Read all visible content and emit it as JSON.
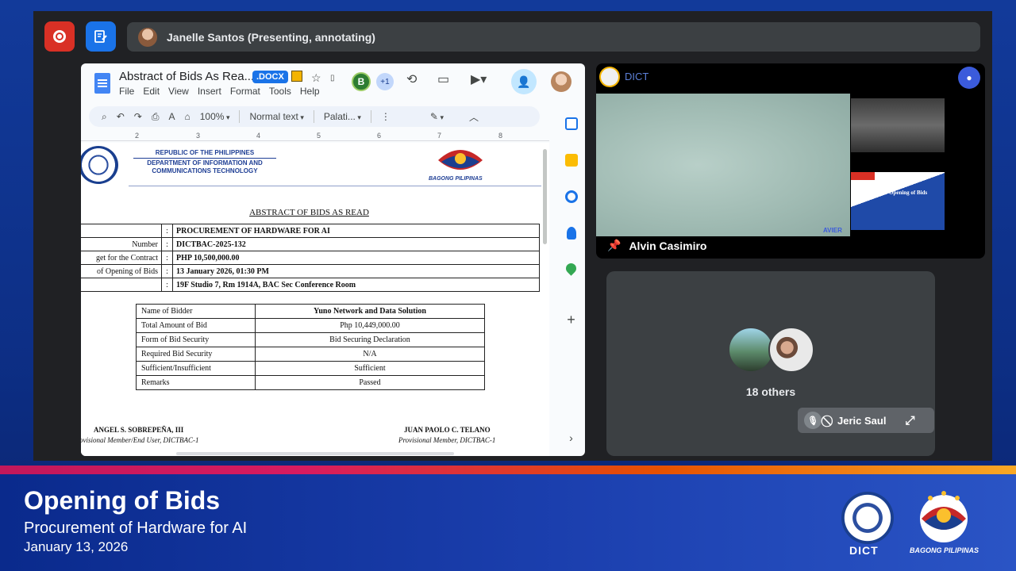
{
  "meet": {
    "presenter_label": "Janelle Santos (Presenting, annotating)"
  },
  "docs": {
    "title": "Abstract of Bids As Rea...",
    "badge": ".DOCX",
    "menu": [
      "File",
      "Edit",
      "View",
      "Insert",
      "Format",
      "Tools",
      "Help"
    ],
    "collaborator_initial": "B",
    "collaborator_more": "+1",
    "toolbar": {
      "zoom": "100%",
      "style": "Normal text",
      "font": "Palati..."
    },
    "ruler_ticks": [
      "2",
      "3",
      "4",
      "5",
      "6",
      "7",
      "8"
    ]
  },
  "document": {
    "agency_line1": "REPUBLIC OF THE PHILIPPINES",
    "agency_line2": "DEPARTMENT OF INFORMATION AND",
    "agency_line3": "COMMUNICATIONS TECHNOLOGY",
    "bp_label": "BAGONG PILIPINAS",
    "heading": "ABSTRACT OF BIDS AS READ",
    "info_rows": [
      {
        "label": "",
        "value": "PROCUREMENT OF HARDWARE FOR AI"
      },
      {
        "label": "Number",
        "value": "DICTBAC-2025-132"
      },
      {
        "label": "get for the Contract",
        "value": "PHP 10,500,000.00"
      },
      {
        "label": "of Opening of Bids",
        "value": "13 January 2026, 01:30 PM"
      },
      {
        "label": "",
        "value": "19F Studio 7, Rm 1914A, BAC Sec Conference Room"
      }
    ],
    "bid_rows": [
      {
        "key": "Name of Bidder",
        "value": "Yuno Network and Data Solution"
      },
      {
        "key": "Total Amount of Bid",
        "value": "Php 10,449,000.00"
      },
      {
        "key": "Form of Bid Security",
        "value": "Bid Securing Declaration"
      },
      {
        "key": "Required Bid Security",
        "value": "N/A"
      },
      {
        "key": "Sufficient/Insufficient",
        "value": "Sufficient"
      },
      {
        "key": "Remarks",
        "value": "Passed"
      }
    ],
    "sig1_name": "ANGEL S. SOBREPEÑA, III",
    "sig1_role": "ovisional Member/End User, DICTBAC-1",
    "sig2_name": "JUAN PAOLO C. TELANO",
    "sig2_role": "Provisional Member, DICTBAC-1"
  },
  "tiles": {
    "dict_small": "DICT",
    "pinned_name": "Alvin Casimiro",
    "slide_title": "Opening of Bids",
    "avier": "AVIER",
    "others_label": "18 others",
    "jeric_name": "Jeric Saul"
  },
  "lower_third": {
    "title": "Opening of Bids",
    "subtitle": "Procurement of Hardware for AI",
    "date": "January 13, 2026",
    "dict_label": "DICT",
    "bp_label": "BAGONG PILIPINAS"
  }
}
